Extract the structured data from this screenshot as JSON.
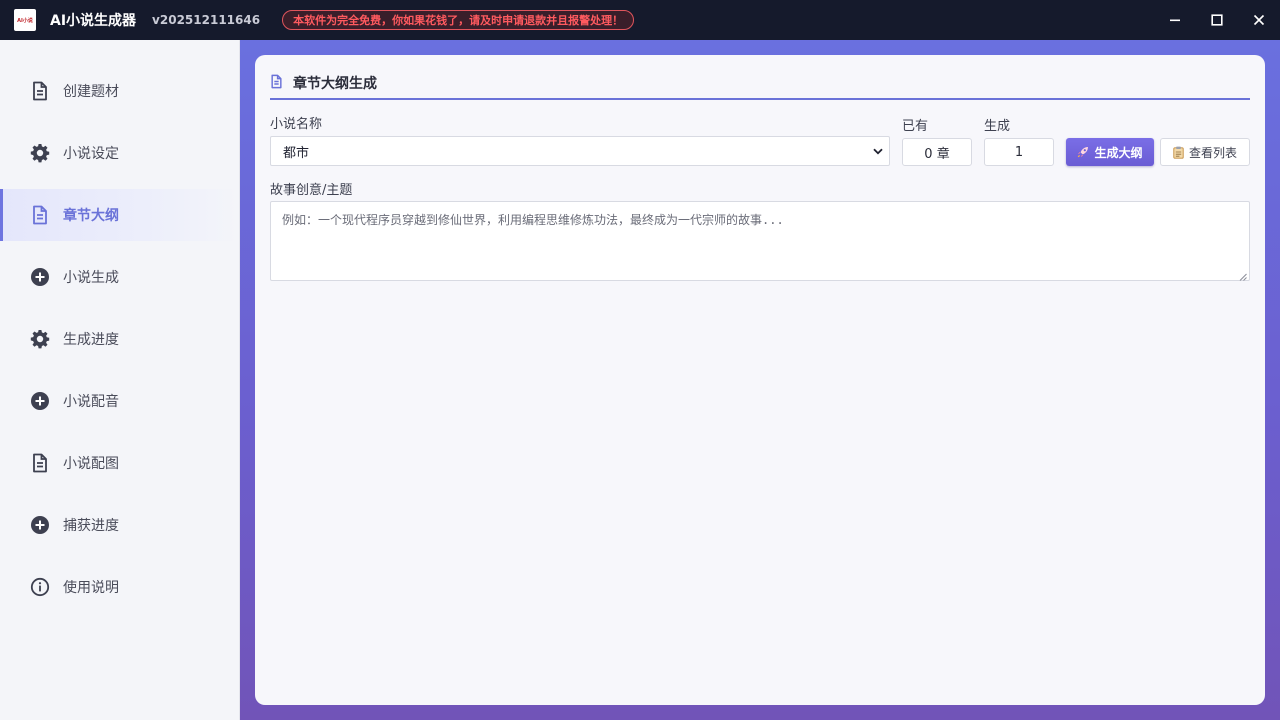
{
  "titlebar": {
    "logo_text": "AI小说",
    "title": "AI小说生成器",
    "version": "v202512111646",
    "notice": "本软件为完全免费，你如果花钱了，请及时申请退款并且报警处理！"
  },
  "sidebar": {
    "items": [
      {
        "label": "创建题材",
        "icon": "document-icon",
        "active": false
      },
      {
        "label": "小说设定",
        "icon": "gear-icon",
        "active": false
      },
      {
        "label": "章节大纲",
        "icon": "document-icon",
        "active": true
      },
      {
        "label": "小说生成",
        "icon": "plus-circle-icon",
        "active": false
      },
      {
        "label": "生成进度",
        "icon": "gear-icon",
        "active": false
      },
      {
        "label": "小说配音",
        "icon": "plus-circle-icon",
        "active": false
      },
      {
        "label": "小说配图",
        "icon": "document-icon",
        "active": false
      },
      {
        "label": "捕获进度",
        "icon": "plus-circle-icon",
        "active": false
      },
      {
        "label": "使用说明",
        "icon": "info-icon",
        "active": false
      }
    ]
  },
  "card": {
    "title": "章节大纲生成",
    "novel_name_label": "小说名称",
    "novel_name_value": "都市",
    "existing_label": "已有",
    "existing_value": "0 章",
    "generate_label": "生成",
    "generate_value": "1",
    "generate_button": "生成大纲",
    "list_button": "查看列表",
    "idea_label": "故事创意/主题",
    "idea_placeholder": "例如：一个现代程序员穿越到修仙世界，利用编程思维修炼功法，最终成为一代宗师的故事..."
  },
  "colors": {
    "titlebar_bg": "#151a2c",
    "accent": "#6a72d8",
    "notice_text": "#ff5a5f"
  }
}
